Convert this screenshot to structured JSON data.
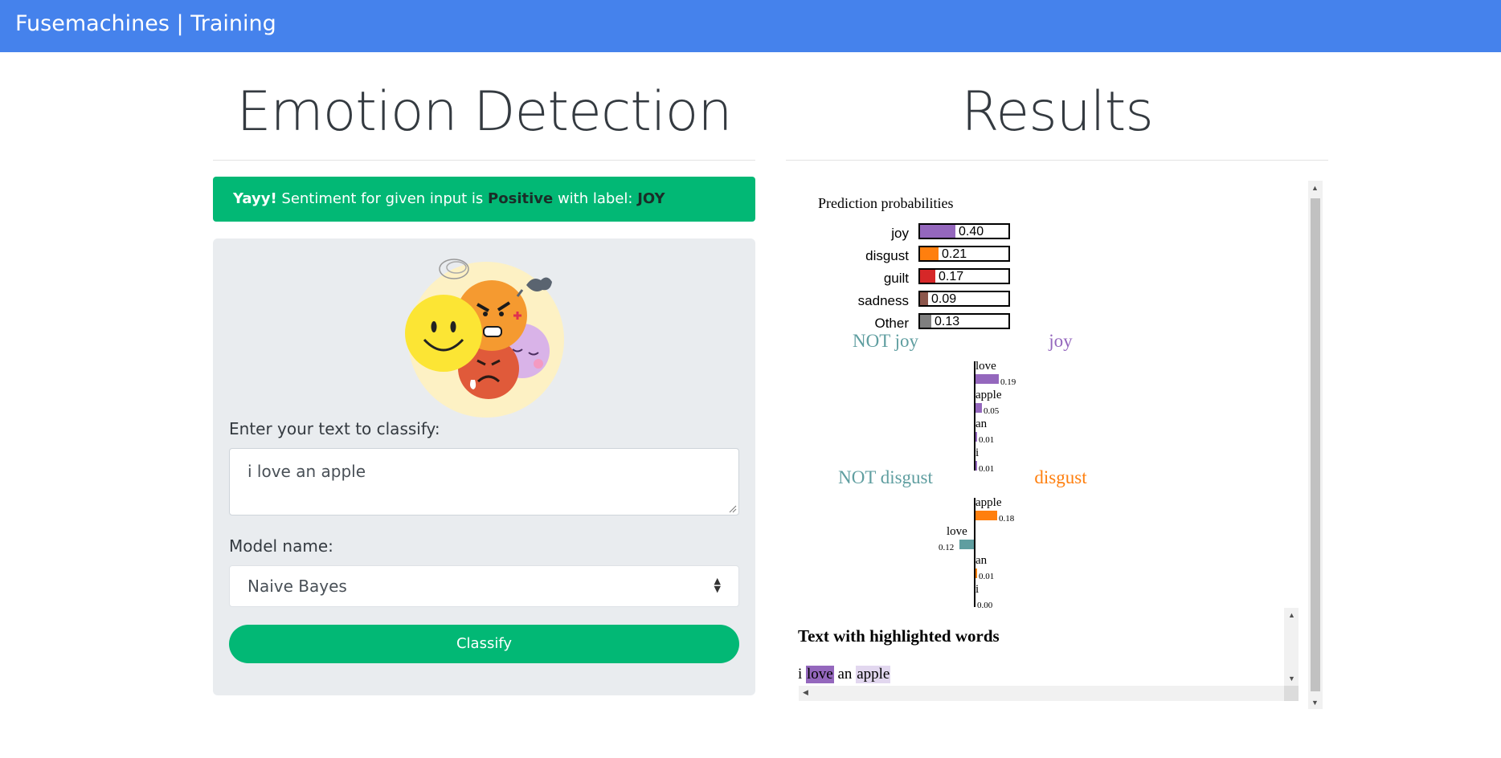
{
  "navbar": {
    "brand": "Fusemachines | Training"
  },
  "left": {
    "title": "Emotion Detection",
    "alert": {
      "prefix": "Yayy!",
      "text1": "Sentiment for given input is",
      "sentiment": "Positive",
      "text2": "with label:",
      "label": "JOY"
    },
    "input_label": "Enter your text to classify:",
    "input_value": "i love an apple",
    "model_label": "Model name:",
    "model_value": "Naive Bayes",
    "button_label": "Classify"
  },
  "right": {
    "title": "Results",
    "prediction_title": "Prediction probabilities",
    "probabilities": [
      {
        "label": "joy",
        "value": "0.40",
        "fraction": 0.4,
        "color": "#9467bd"
      },
      {
        "label": "disgust",
        "value": "0.21",
        "fraction": 0.21,
        "color": "#ff7f0e"
      },
      {
        "label": "guilt",
        "value": "0.17",
        "fraction": 0.17,
        "color": "#d62728"
      },
      {
        "label": "sadness",
        "value": "0.09",
        "fraction": 0.09,
        "color": "#8c564b"
      },
      {
        "label": "Other",
        "value": "0.13",
        "fraction": 0.13,
        "color": "#7f7f7f"
      }
    ],
    "explanations": [
      {
        "not_label": "NOT joy",
        "label": "joy",
        "color": "#9467bd",
        "features": [
          {
            "word": "love",
            "value": "0.19",
            "side": "pos"
          },
          {
            "word": "apple",
            "value": "0.05",
            "side": "pos"
          },
          {
            "word": "an",
            "value": "0.01",
            "side": "pos"
          },
          {
            "word": "i",
            "value": "0.01",
            "side": "pos"
          }
        ]
      },
      {
        "not_label": "NOT disgust",
        "label": "disgust",
        "color": "#ff7f0e",
        "features": [
          {
            "word": "apple",
            "value": "0.18",
            "side": "pos"
          },
          {
            "word": "love",
            "value": "0.12",
            "side": "neg"
          },
          {
            "word": "an",
            "value": "0.01",
            "side": "pos"
          },
          {
            "word": "i",
            "value": "0.00",
            "side": "pos"
          }
        ]
      }
    ],
    "highlight_title": "Text with highlighted words",
    "highlight_words": [
      {
        "word": "i",
        "highlight": "none"
      },
      {
        "word": "love",
        "highlight": "#9467bd"
      },
      {
        "word": "an",
        "highlight": "none"
      },
      {
        "word": "apple",
        "highlight": "#e2d7ef"
      }
    ],
    "not_color": "#5f9ea0"
  }
}
